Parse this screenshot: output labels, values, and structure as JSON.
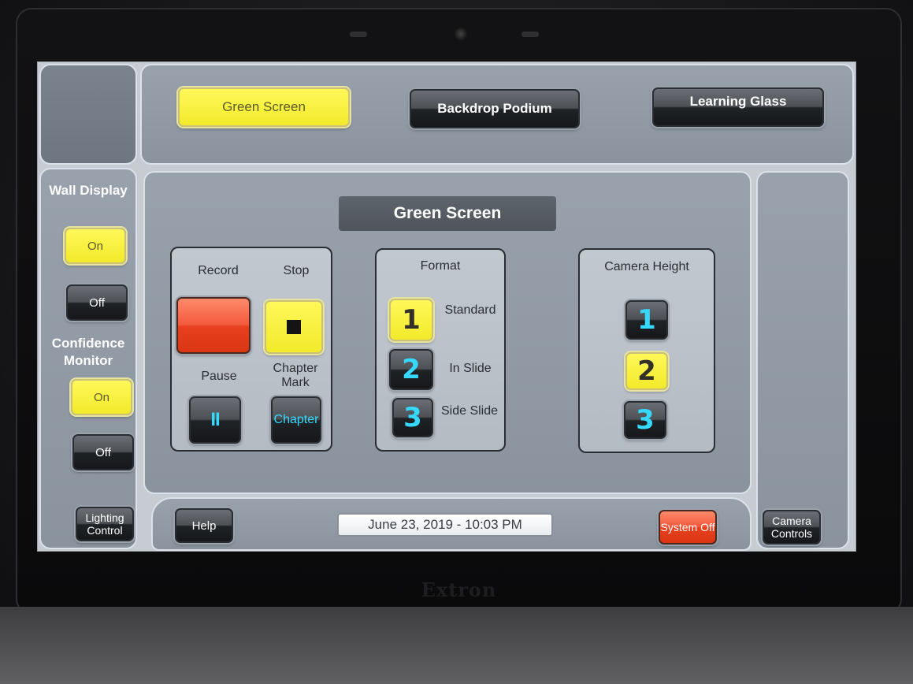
{
  "brand": "Extron",
  "tabs": [
    {
      "label": "Green Screen",
      "active": true
    },
    {
      "label": "Backdrop Podium",
      "active": false
    },
    {
      "label": "Learning Glass",
      "active": false
    }
  ],
  "sidebar": {
    "wall_display": {
      "label": "Wall Display",
      "on": "On",
      "off": "Off",
      "state": "On"
    },
    "confidence_monitor": {
      "label": "Confidence Monitor",
      "on": "On",
      "off": "Off",
      "state": "On"
    },
    "lighting_control": "Lighting Control"
  },
  "main": {
    "title": "Green Screen",
    "record_group": {
      "record_label": "Record",
      "stop_label": "Stop",
      "pause_label": "Pause",
      "chapter_mark_label": "Chapter Mark",
      "chapter_button": "Chapter",
      "pause_glyph": "II"
    },
    "format_group": {
      "title": "Format",
      "options": [
        {
          "number": "1",
          "label": "Standard",
          "selected": true
        },
        {
          "number": "2",
          "label": "In Slide",
          "selected": false
        },
        {
          "number": "3",
          "label": "Side Slide",
          "selected": false
        }
      ]
    },
    "camera_height_group": {
      "title": "Camera Height",
      "options": [
        {
          "number": "1",
          "selected": false
        },
        {
          "number": "2",
          "selected": true
        },
        {
          "number": "3",
          "selected": false
        }
      ]
    }
  },
  "footer": {
    "help": "Help",
    "datetime": "June 23, 2019  -  10:03 PM",
    "system_off": "System Off",
    "camera_controls": "Camera Controls"
  },
  "colors": {
    "active_yellow": "#f7ef3a",
    "record_red": "#e8401f",
    "number_cyan": "#35d9ff",
    "panel_blue_gray": "#8e97a2"
  }
}
